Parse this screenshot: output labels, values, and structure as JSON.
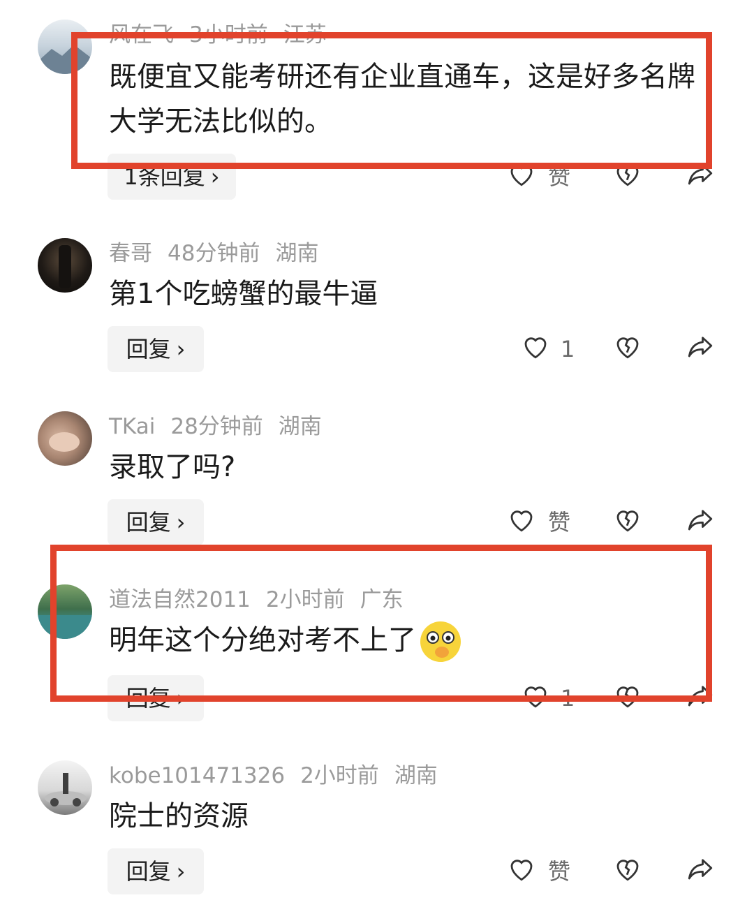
{
  "comments": [
    {
      "user": "风在飞",
      "time": "3小时前",
      "region": "江苏",
      "text": "既便宜又能考研还有企业直通车，这是好多名牌大学无法比似的。",
      "reply_label": "1条回复",
      "likes": "赞"
    },
    {
      "user": "春哥",
      "time": "48分钟前",
      "region": "湖南",
      "text": "第1个吃螃蟹的最牛逼",
      "reply_label": "回复",
      "likes": "1"
    },
    {
      "user": "TKai",
      "time": "28分钟前",
      "region": "湖南",
      "text": "录取了吗?",
      "reply_label": "回复",
      "likes": "赞"
    },
    {
      "user": "道法自然2011",
      "time": "2小时前",
      "region": "广东",
      "text": "明年这个分绝对考不上了",
      "emoji": "🤭",
      "reply_label": "回复",
      "likes": "1"
    },
    {
      "user": "kobe101471326",
      "time": "2小时前",
      "region": "湖南",
      "text": "院士的资源",
      "reply_label": "回复",
      "likes": "赞"
    }
  ],
  "icons": {
    "like": "heart-outline-icon",
    "dislike": "broken-heart-icon",
    "share": "share-arrow-icon",
    "chevron": "chevron-right-icon"
  },
  "colors": {
    "highlight_box": "#e1432c",
    "meta_text": "#9a9a9a",
    "reply_bg": "#f3f3f3"
  }
}
